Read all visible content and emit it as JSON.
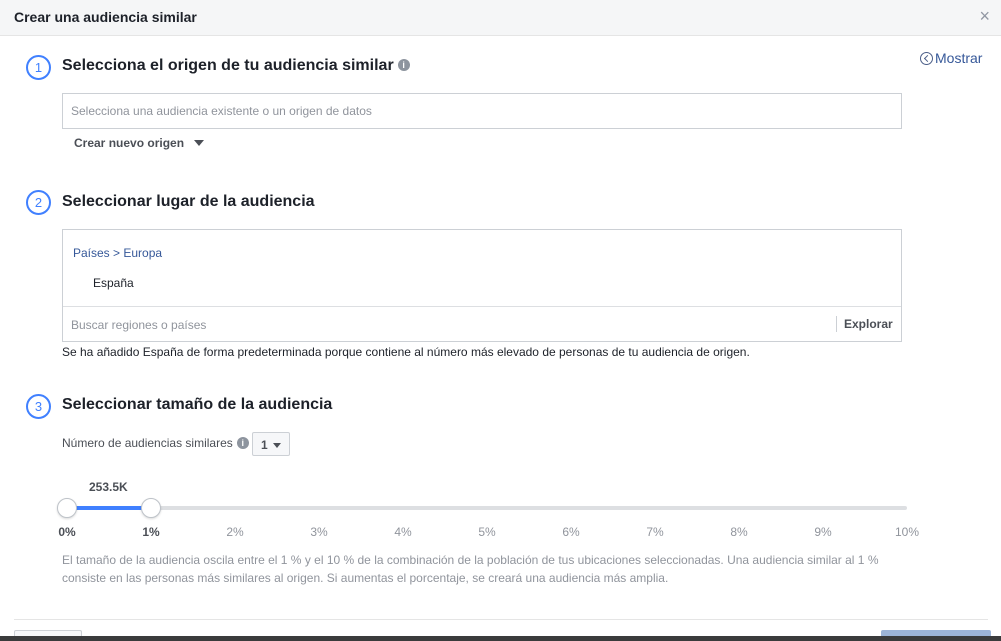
{
  "dialog": {
    "title": "Crear una audiencia similar",
    "close_symbol": "×",
    "show_link": "Mostrar"
  },
  "steps": [
    {
      "number": "1",
      "title": "Selecciona el origen de tu audiencia similar"
    },
    {
      "number": "2",
      "title": "Seleccionar lugar de la audiencia"
    },
    {
      "number": "3",
      "title": "Seleccionar tamaño de la audiencia"
    }
  ],
  "source": {
    "placeholder": "Selecciona una audiencia existente o un origen de datos",
    "create_new": "Crear nuevo origen"
  },
  "location": {
    "breadcrumb": "Países > Europa",
    "selected": "España",
    "search_placeholder": "Buscar regiones o países",
    "explore": "Explorar",
    "note": "Se ha añadido España de forma predeterminada porque contiene al número más elevado de personas de tu audiencia de origen."
  },
  "size": {
    "count_label": "Número de audiencias similares",
    "count_value": "1",
    "slider_value": "253.5K",
    "range_start_percent": 0,
    "range_end_percent": 1,
    "ticks": [
      "0%",
      "1%",
      "2%",
      "3%",
      "4%",
      "5%",
      "6%",
      "7%",
      "8%",
      "9%",
      "10%"
    ],
    "description": "El tamaño de la audiencia oscila entre el 1 % y el 10 % de la combinación de la población de tus ubicaciones seleccionadas. Una audiencia similar al 1 % consiste en las personas más similares al origen. Si aumentas el porcentaje, se creará una audiencia más amplia."
  },
  "icons": {
    "info": "info-icon",
    "close": "close-icon",
    "collapse": "chevron-left-circle-icon",
    "dropdown": "caret-down-icon"
  },
  "colors": {
    "accent": "#4080ff",
    "link": "#365899"
  }
}
